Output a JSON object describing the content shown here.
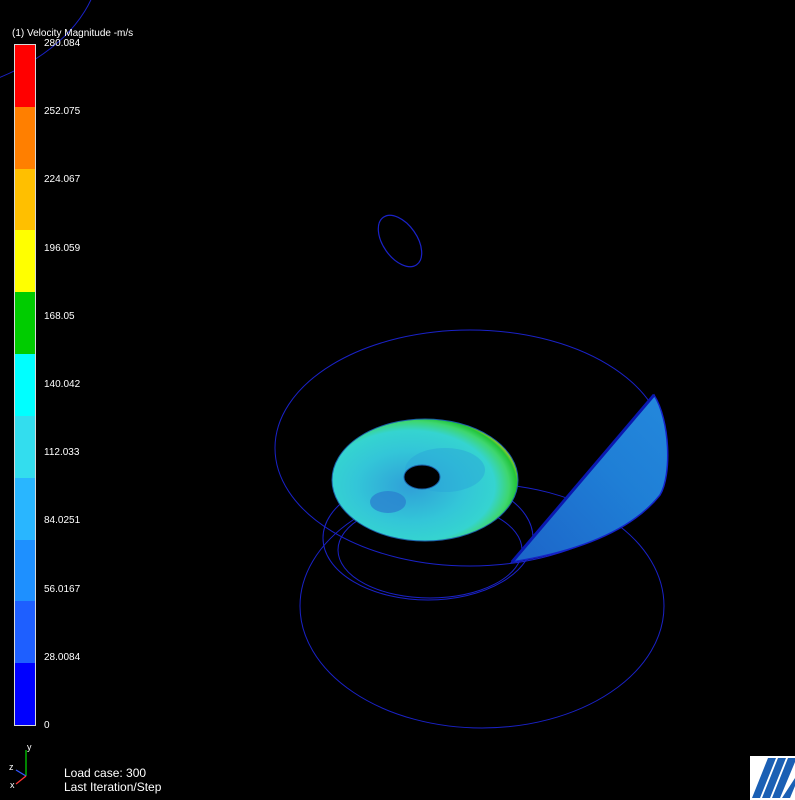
{
  "legend": {
    "title": "(1) Velocity Magnitude -m/s",
    "ticks": [
      "280.084",
      "252.075",
      "224.067",
      "196.059",
      "168.05",
      "140.042",
      "112.033",
      "84.0251",
      "56.0167",
      "28.0084",
      "0"
    ],
    "colors": [
      "#ff0000",
      "#ff7f00",
      "#ffbf00",
      "#ffff00",
      "#00cc00",
      "#00ffff",
      "#33ddee",
      "#29b6ff",
      "#1e90ff",
      "#1e5fff",
      "#0000ff"
    ]
  },
  "status": {
    "load_case": "Load case: 300",
    "step": "Last Iteration/Step"
  },
  "triad": {
    "y_label": "y",
    "z_label": "z",
    "x_label": "x"
  },
  "colors": {
    "background": "#000000",
    "wireframe": "#1a22c8",
    "disc_base": "#33bbcc",
    "section_plane": "#1e7fd6"
  },
  "icons": {
    "triad": "axis-triad-icon",
    "logo": "vendor-logo-icon"
  }
}
